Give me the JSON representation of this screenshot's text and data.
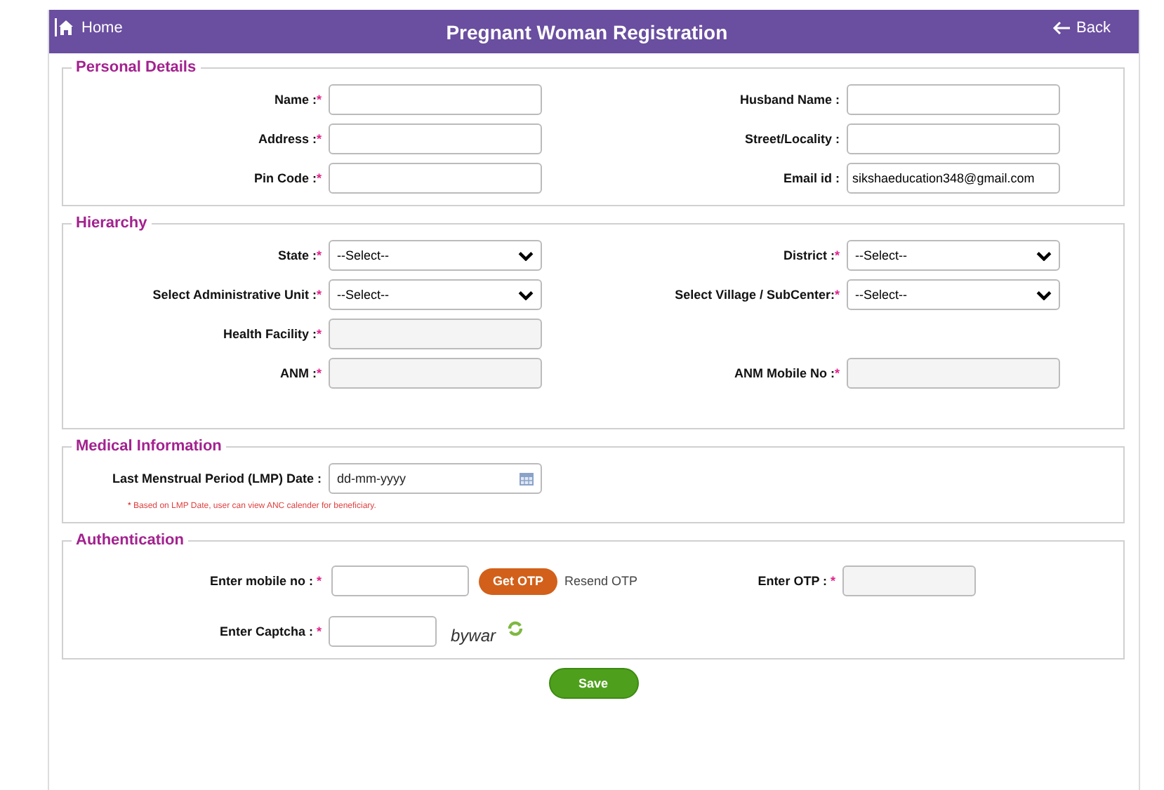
{
  "header": {
    "home": "Home",
    "title": "Pregnant Woman Registration",
    "back": "Back"
  },
  "sections": [
    {
      "title": "Personal Details",
      "rows": [
        [
          {
            "label": "Name :",
            "mark": "*",
            "kind": "text"
          },
          {
            "label": "Husband Name :",
            "kind": "text"
          }
        ],
        [
          {
            "label": "Address :",
            "mark": "*",
            "kind": "text"
          },
          {
            "label": "Street/Locality :",
            "kind": "text"
          }
        ],
        [
          {
            "label": "Pin Code :",
            "mark": "*",
            "kind": "text"
          },
          {
            "label": "Email id :",
            "kind": "text",
            "value": "sikshaeducation348@gmail.com"
          }
        ]
      ]
    },
    {
      "title": "Hierarchy",
      "rows": [
        [
          {
            "label": "State :",
            "mark": "*",
            "kind": "select",
            "value": "--Select--"
          },
          {
            "label": "District :",
            "mark": "*",
            "kind": "select",
            "value": "--Select--"
          }
        ],
        [
          {
            "label": "Select Administrative Unit :",
            "mark": "*",
            "kind": "select",
            "value": "--Select--"
          },
          {
            "label": "Select Village / SubCenter:",
            "mark": "*",
            "kind": "select",
            "value": "--Select--"
          }
        ],
        [
          {
            "label": "Health Facility :",
            "mark": "*",
            "kind": "disabled"
          }
        ],
        [
          {
            "label": "ANM :",
            "mark": "*",
            "kind": "disabled"
          },
          {
            "label": "ANM Mobile No :",
            "mark": "*",
            "kind": "disabled"
          }
        ]
      ]
    }
  ],
  "medical": {
    "title": "Medical Information",
    "lmp": {
      "label": "Last Menstrual Period (LMP) Date :",
      "placeholder": "dd-mm-yyyy"
    },
    "note": {
      "mark": "*",
      "text": "Based on LMP Date, user can view ANC calender for beneficiary."
    }
  },
  "auth": {
    "title": "Authentication",
    "mobile": {
      "label": "Enter mobile no :",
      "mark": "*"
    },
    "get_otp": "Get OTP",
    "resend_otp": "Resend OTP",
    "otp": {
      "label": "Enter OTP :",
      "mark": "*"
    },
    "captcha": {
      "label": "Enter Captcha :",
      "mark": "*"
    },
    "captcha_text": "bywar"
  },
  "save": "Save"
}
